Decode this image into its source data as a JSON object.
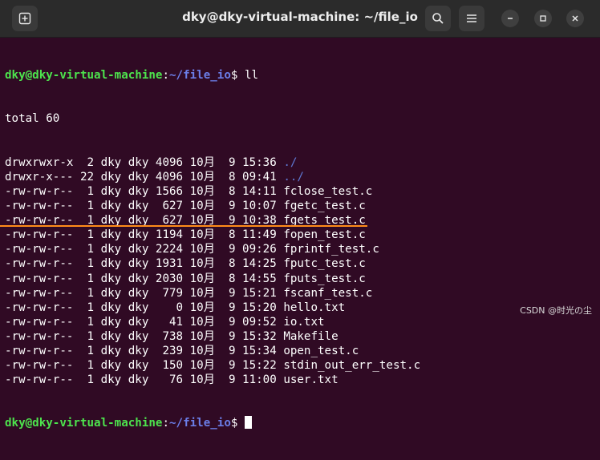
{
  "titlebar": {
    "title": "dky@dky-virtual-machine: ~/file_io",
    "new_tab_icon": "new-tab-icon",
    "search_icon": "search-icon",
    "menu_icon": "hamburger-menu-icon",
    "minimize_icon": "minimize-icon",
    "maximize_icon": "maximize-icon",
    "close_icon": "close-icon"
  },
  "terminal": {
    "prompt_user": "dky@dky-virtual-machine",
    "prompt_sep": ":",
    "prompt_path": "~/file_io",
    "prompt_end": "$ ",
    "command": "ll",
    "total": "total 60",
    "entries": [
      {
        "prefix": "drwxrwxr-x  2 dky dky 4096 10月  9 15:36 ",
        "name": "./",
        "dir": true
      },
      {
        "prefix": "drwxr-x--- 22 dky dky 4096 10月  8 09:41 ",
        "name": "../",
        "dir": true
      },
      {
        "prefix": "-rw-rw-r--  1 dky dky 1566 10月  8 14:11 ",
        "name": "fclose_test.c",
        "dir": false
      },
      {
        "prefix": "-rw-rw-r--  1 dky dky  627 10月  9 10:07 ",
        "name": "fgetc_test.c",
        "dir": false
      },
      {
        "prefix": "-rw-rw-r--  1 dky dky  627 10月  9 10:38 ",
        "name": "fgets_test.c",
        "dir": false
      },
      {
        "prefix": "-rw-rw-r--  1 dky dky 1194 10月  8 11:49 ",
        "name": "fopen_test.c",
        "dir": false
      },
      {
        "prefix": "-rw-rw-r--  1 dky dky 2224 10月  9 09:26 ",
        "name": "fprintf_test.c",
        "dir": false
      },
      {
        "prefix": "-rw-rw-r--  1 dky dky 1931 10月  8 14:25 ",
        "name": "fputc_test.c",
        "dir": false
      },
      {
        "prefix": "-rw-rw-r--  1 dky dky 2030 10月  8 14:55 ",
        "name": "fputs_test.c",
        "dir": false
      },
      {
        "prefix": "-rw-rw-r--  1 dky dky  779 10月  9 15:21 ",
        "name": "fscanf_test.c",
        "dir": false
      },
      {
        "prefix": "-rw-rw-r--  1 dky dky    0 10月  9 15:20 ",
        "name": "hello.txt",
        "dir": false
      },
      {
        "prefix": "-rw-rw-r--  1 dky dky   41 10月  9 09:52 ",
        "name": "io.txt",
        "dir": false
      },
      {
        "prefix": "-rw-rw-r--  1 dky dky  738 10月  9 15:32 ",
        "name": "Makefile",
        "dir": false
      },
      {
        "prefix": "-rw-rw-r--  1 dky dky  239 10月  9 15:34 ",
        "name": "open_test.c",
        "dir": false
      },
      {
        "prefix": "-rw-rw-r--  1 dky dky  150 10月  9 15:22 ",
        "name": "stdin_out_err_test.c",
        "dir": false
      },
      {
        "prefix": "-rw-rw-r--  1 dky dky   76 10月  9 11:00 ",
        "name": "user.txt",
        "dir": false
      }
    ],
    "dir_color": "#5f79d4",
    "annotation_color": "#ff8c1a"
  },
  "watermark": "CSDN @时光の尘"
}
